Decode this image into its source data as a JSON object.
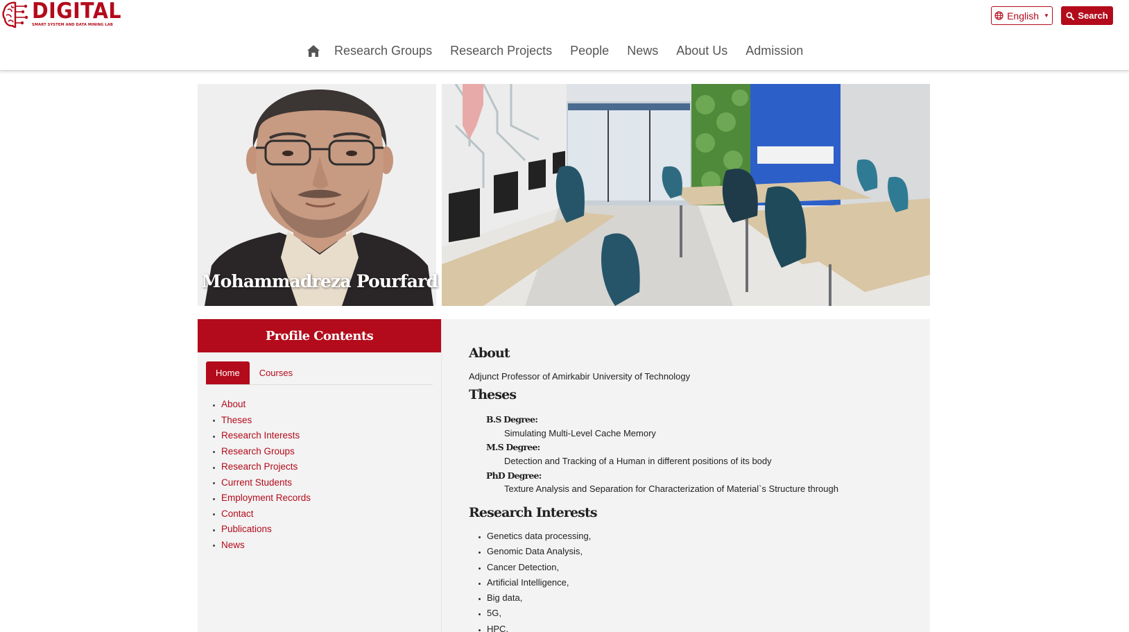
{
  "header": {
    "logo": {
      "title": "DIGITAL",
      "subtitle": "SMART SYSTEM AND DATA MINING LAB"
    },
    "language_button": "English",
    "search_button": "Search",
    "nav": [
      "Research Groups",
      "Research Projects",
      "People",
      "News",
      "About Us",
      "Admission"
    ]
  },
  "profile": {
    "name": "Mohammadreza Pourfard"
  },
  "sidebar": {
    "title": "Profile Contents",
    "tabs": [
      "Home",
      "Courses"
    ],
    "active_tab": "Home",
    "links": [
      "About",
      "Theses",
      "Research Interests",
      "Research Groups",
      "Research Projects",
      "Current Students",
      "Employment Records",
      "Contact",
      "Publications",
      "News"
    ]
  },
  "content": {
    "about": {
      "heading": "About",
      "text": "Adjunct Professor of Amirkabir University of Technology"
    },
    "theses": {
      "heading": "Theses",
      "items": [
        {
          "degree": "B.S Degree:",
          "title": "Simulating Multi-Level Cache Memory"
        },
        {
          "degree": "M.S Degree:",
          "title": "Detection and Tracking of a Human in different positions of its body"
        },
        {
          "degree": "PhD Degree:",
          "title": "Texture Analysis and Separation for Characterization of Material`s Structure through"
        }
      ]
    },
    "research_interests": {
      "heading": "Research Interests",
      "items": [
        "Genetics data processing,",
        "Genomic Data Analysis,",
        "Cancer Detection,",
        "Artificial Intelligence,",
        "Big data,",
        "5G,",
        "HPC,"
      ]
    }
  },
  "colors": {
    "brand": "#b30b1b",
    "panel": "#f3f3f3"
  }
}
